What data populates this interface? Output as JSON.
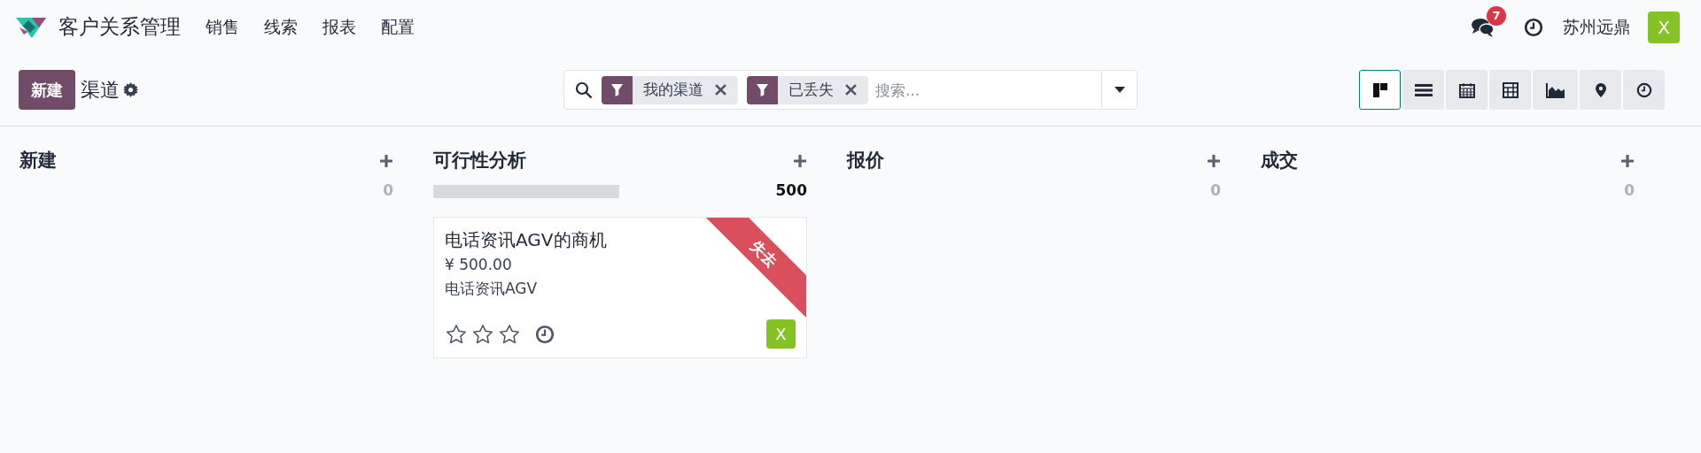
{
  "app": {
    "title": "客户关系管理",
    "menu": [
      "销售",
      "线索",
      "报表",
      "配置"
    ],
    "messages_badge": "7",
    "company": "苏州远鼎",
    "user_avatar": "X"
  },
  "control_panel": {
    "new_button": "新建",
    "breadcrumb": "渠道",
    "search": {
      "facets": [
        {
          "label": "我的渠道"
        },
        {
          "label": "已丢失"
        }
      ],
      "placeholder": "搜索..."
    },
    "views": [
      {
        "kind": "kanban",
        "selected": true
      },
      {
        "kind": "list",
        "selected": false
      },
      {
        "kind": "calendar",
        "selected": false
      },
      {
        "kind": "pivot",
        "selected": false
      },
      {
        "kind": "graph",
        "selected": false
      },
      {
        "kind": "map",
        "selected": false
      },
      {
        "kind": "activity",
        "selected": false
      }
    ]
  },
  "columns": [
    {
      "title": "新建",
      "total": "0"
    },
    {
      "title": "可行性分析",
      "total": "500",
      "cards": [
        {
          "title": "电话资讯AGV的商机",
          "amount": "¥ 500.00",
          "customer": "电话资讯AGV",
          "ribbon": "失去",
          "stars": 0,
          "avatar": "X"
        }
      ]
    },
    {
      "title": "报价",
      "total": "0"
    },
    {
      "title": "成交",
      "total": "0"
    }
  ]
}
